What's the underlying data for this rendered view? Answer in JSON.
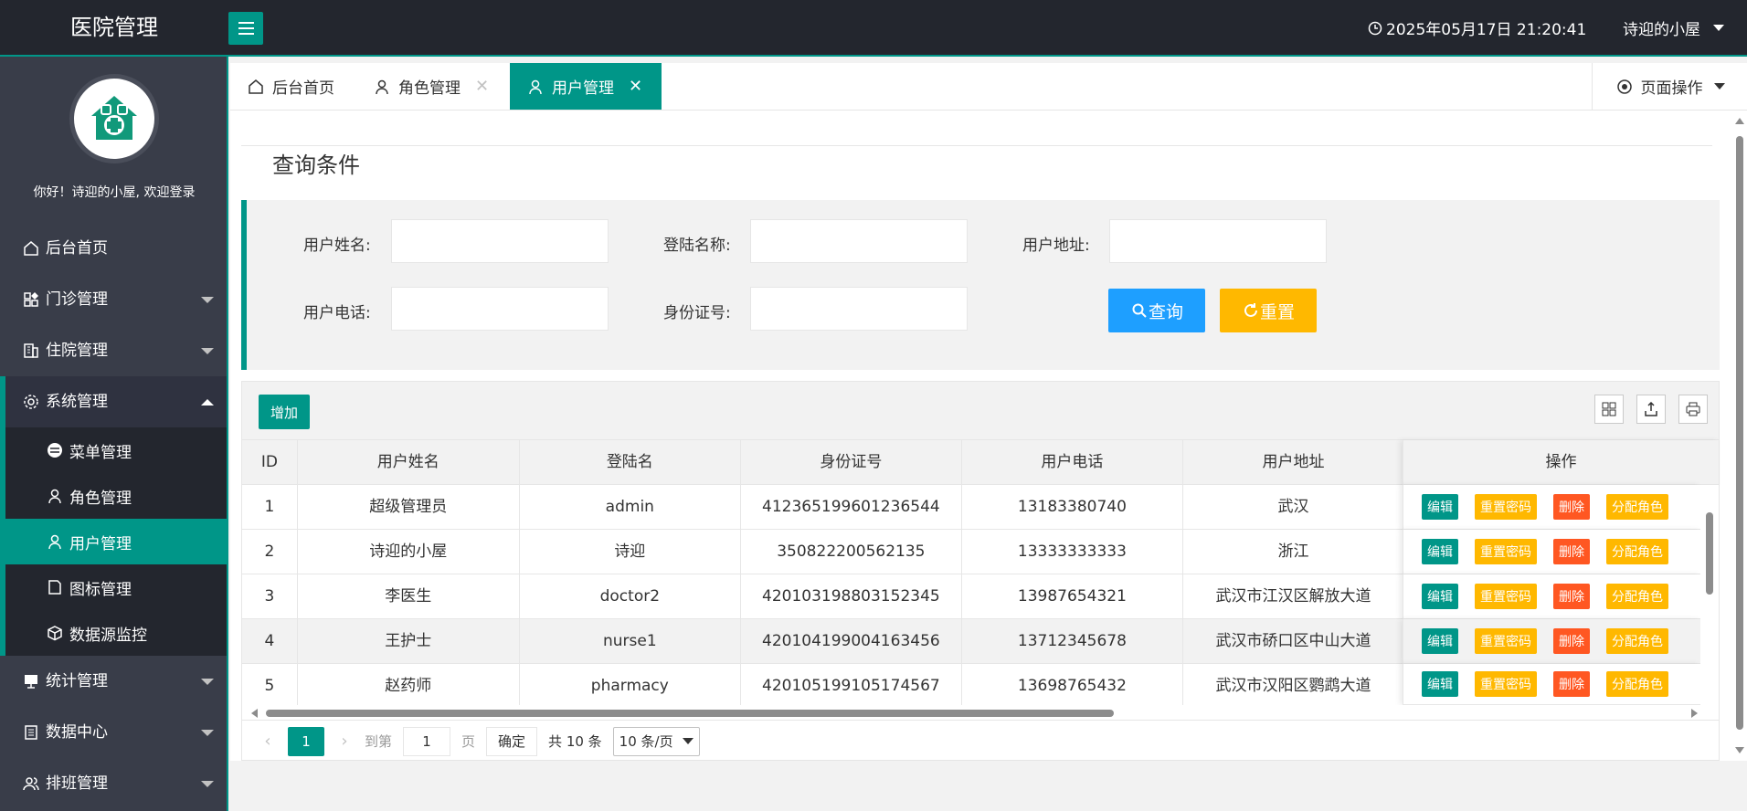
{
  "header": {
    "app_title": "医院管理",
    "datetime": "2025年05月17日 21:20:41",
    "user": "诗迎的小屋"
  },
  "sidebar": {
    "welcome": "你好！诗迎的小屋, 欢迎登录",
    "items": [
      {
        "label": "后台首页",
        "icon": "home-icon"
      },
      {
        "label": "门诊管理",
        "icon": "apps-icon"
      },
      {
        "label": "住院管理",
        "icon": "building-icon"
      },
      {
        "label": "系统管理",
        "icon": "gear-icon"
      },
      {
        "label": "统计管理",
        "icon": "chart-icon"
      },
      {
        "label": "数据中心",
        "icon": "database-icon"
      },
      {
        "label": "排班管理",
        "icon": "users-icon"
      }
    ],
    "sub_items": [
      {
        "label": "菜单管理",
        "icon": "menu-icon"
      },
      {
        "label": "角色管理",
        "icon": "user-icon"
      },
      {
        "label": "用户管理",
        "icon": "user-icon"
      },
      {
        "label": "图标管理",
        "icon": "doc-icon"
      },
      {
        "label": "数据源监控",
        "icon": "cube-icon"
      }
    ]
  },
  "tabs": [
    {
      "label": "后台首页"
    },
    {
      "label": "角色管理"
    },
    {
      "label": "用户管理"
    }
  ],
  "page_ops_label": "页面操作",
  "search": {
    "legend": "查询条件",
    "fields": {
      "name": "用户姓名:",
      "login": "登陆名称:",
      "address": "用户地址:",
      "phone": "用户电话:",
      "idcard": "身份证号:"
    },
    "query_label": "查询",
    "reset_label": "重置"
  },
  "table": {
    "add_label": "增加",
    "columns": [
      "ID",
      "用户姓名",
      "登陆名",
      "身份证号",
      "用户电话",
      "用户地址"
    ],
    "ops_header": "操作",
    "op_labels": {
      "edit": "编辑",
      "pwd": "重置密码",
      "del": "删除",
      "role": "分配角色"
    },
    "rows": [
      [
        "1",
        "超级管理员",
        "admin",
        "412365199601236544",
        "13183380740",
        "武汉"
      ],
      [
        "2",
        "诗迎的小屋",
        "诗迎",
        "350822200562135",
        "13333333333",
        "浙江"
      ],
      [
        "3",
        "李医生",
        "doctor2",
        "420103198803152345",
        "13987654321",
        "武汉市江汉区解放大道"
      ],
      [
        "4",
        "王护士",
        "nurse1",
        "420104199004163456",
        "13712345678",
        "武汉市硚口区中山大道"
      ],
      [
        "5",
        "赵药师",
        "pharmacy",
        "420105199105174567",
        "13698765432",
        "武汉市汉阳区鹦鹉大道"
      ]
    ]
  },
  "pager": {
    "current": "1",
    "goto_label": "到第",
    "goto_value": "1",
    "page_label": "页",
    "confirm_label": "确定",
    "total_label": "共 10 条",
    "per_page": "10 条/页"
  }
}
